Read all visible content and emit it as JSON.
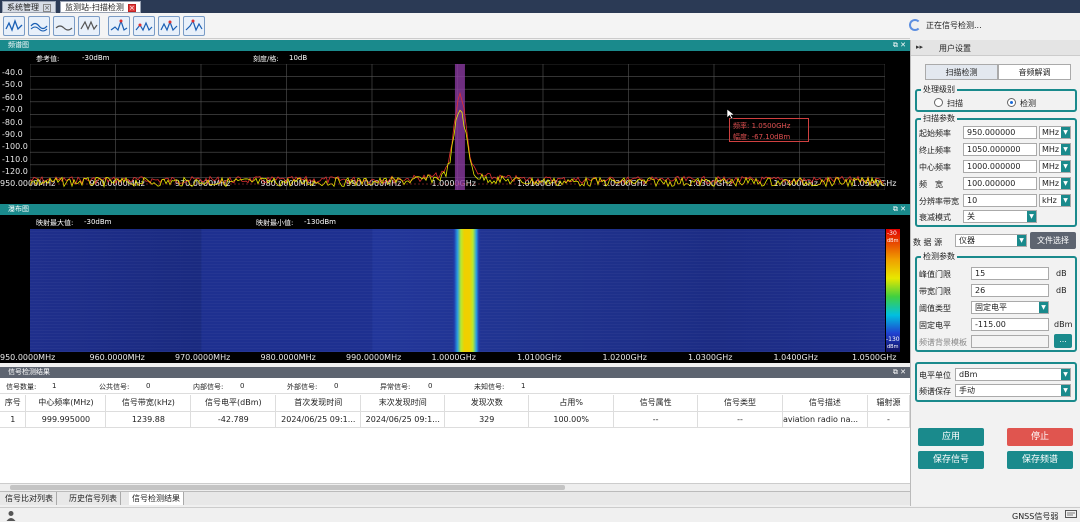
{
  "tabs": [
    {
      "label": "系统管理",
      "active": false
    },
    {
      "label": "监测站-扫描检测",
      "active": true
    }
  ],
  "status": {
    "text": "正在信号检测..."
  },
  "spectrum_panel": {
    "title": "频谱图",
    "ref_label": "参考值:",
    "ref_value": "-30dBm",
    "scale_label": "刻度/格:",
    "scale_value": "10dB",
    "y_ticks": [
      "-40.0",
      "-50.0",
      "-60.0",
      "-70.0",
      "-80.0",
      "-90.0",
      "-100.0",
      "-110.0",
      "-120.0"
    ],
    "x_ticks": [
      "950.0000MHz",
      "960.0000MHz",
      "970.0000MHz",
      "980.0000MHz",
      "990.0000MHz",
      "1.0000GHz",
      "1.0100GHz",
      "1.0200GHz",
      "1.0300GHz",
      "1.0400GHz",
      "1.0500GHz"
    ],
    "marker_freq": "频率: 1.0500GHz",
    "marker_amp": "幅度: -67.10dBm"
  },
  "waterfall_panel": {
    "title": "瀑布图",
    "max_label": "映射最大值:",
    "max_value": "-30dBm",
    "min_label": "映射最小值:",
    "min_value": "-130dBm",
    "scale_top": "-30",
    "scale_top_unit": "dBm",
    "scale_bottom": "-130",
    "scale_bottom_unit": "dBm"
  },
  "results_panel": {
    "title": "信号检测结果",
    "summary": [
      {
        "label": "信号数量:",
        "value": "1"
      },
      {
        "label": "公共信号:",
        "value": "0"
      },
      {
        "label": "内部信号:",
        "value": "0"
      },
      {
        "label": "外部信号:",
        "value": "0"
      },
      {
        "label": "异常信号:",
        "value": "0"
      },
      {
        "label": "未知信号:",
        "value": "1"
      }
    ],
    "columns": [
      "序号",
      "中心频率(MHz)",
      "信号带宽(kHz)",
      "信号电平(dBm)",
      "首次发现时间",
      "末次发现时间",
      "发现次数",
      "占用%",
      "信号属性",
      "信号类型",
      "信号描述",
      "辐射源"
    ],
    "rows": [
      [
        "1",
        "999.995000",
        "1239.88",
        "-42.789",
        "2024/06/25 09:1...",
        "2024/06/25 09:1...",
        "329",
        "100.00%",
        "--",
        "--",
        "aviation radio na...",
        "-"
      ]
    ]
  },
  "bottom_tabs": [
    {
      "label": "信号比对列表",
      "active": false
    },
    {
      "label": "历史信号列表",
      "active": false
    },
    {
      "label": "信号检测结果",
      "active": true
    }
  ],
  "footer": {
    "right_text": "GNSS信号弱"
  },
  "right_panel": {
    "title": "用户设置",
    "tabs": [
      {
        "label": "扫描检测",
        "active": true
      },
      {
        "label": "音频解调",
        "active": false
      }
    ],
    "process_level": {
      "title": "处理级别",
      "options": [
        {
          "label": "扫描",
          "selected": false
        },
        {
          "label": "检测",
          "selected": true
        }
      ]
    },
    "scan_params": {
      "title": "扫描参数",
      "fields": [
        {
          "label": "起始频率",
          "value": "950.000000",
          "unit": "MHz"
        },
        {
          "label": "终止频率",
          "value": "1050.000000",
          "unit": "MHz"
        },
        {
          "label": "中心频率",
          "value": "1000.000000",
          "unit": "MHz"
        },
        {
          "label": "频　宽",
          "value": "100.000000",
          "unit": "MHz"
        },
        {
          "label": "分辨率带宽",
          "value": "10",
          "unit": "kHz"
        }
      ],
      "attenuation_label": "衰减模式",
      "attenuation_value": "关"
    },
    "data_source": {
      "label": "数 据 源",
      "value": "仪器",
      "file_button": "文件选择"
    },
    "detect_params": {
      "title": "检测参数",
      "peak_label": "峰值门限",
      "peak_value": "15",
      "peak_unit": "dB",
      "bw_label": "带宽门限",
      "bw_value": "26",
      "bw_unit": "dB",
      "thr_type_label": "阈值类型",
      "thr_type_value": "固定电平",
      "fixed_label": "固定电平",
      "fixed_value": "-115.00",
      "fixed_unit": "dBm",
      "template_label": "频谱背景模板",
      "template_button": "..."
    },
    "level_unit": {
      "label": "电平单位",
      "value": "dBm"
    },
    "spectrum_save": {
      "label": "频谱保存",
      "value": "手动"
    },
    "buttons": {
      "apply": "应用",
      "stop": "停止",
      "save_signal": "保存信号",
      "save_spectrum": "保存频谱"
    }
  },
  "colors": {
    "teal": "#1a8a8c",
    "red": "#e0554f",
    "trace_yellow": "#e8e800",
    "trace_red": "#e03030",
    "marker_band": "#8a3aa0"
  }
}
